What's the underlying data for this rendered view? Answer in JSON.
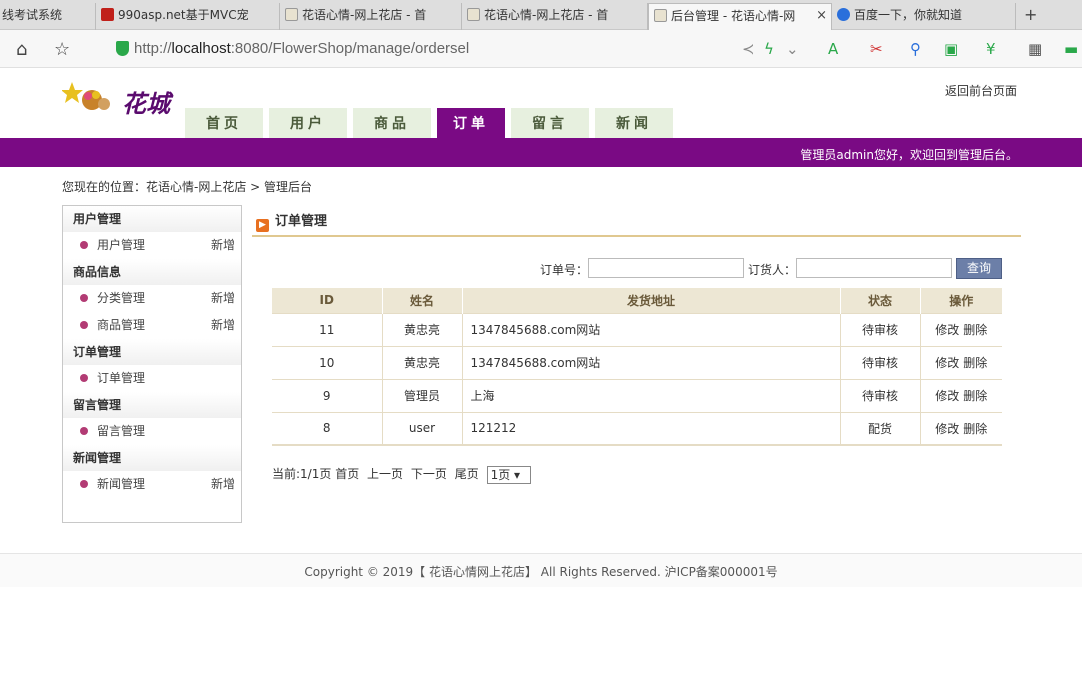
{
  "browser": {
    "tabs": [
      {
        "title": "线考试系统",
        "active": false
      },
      {
        "title": "990asp.net基于MVC宠",
        "active": false
      },
      {
        "title": "花语心情-网上花店 - 首",
        "active": false
      },
      {
        "title": "花语心情-网上花店 - 首",
        "active": false
      },
      {
        "title": "后台管理 - 花语心情-网",
        "active": true
      },
      {
        "title": "百度一下，你就知道",
        "active": false
      }
    ],
    "close_glyph": "×",
    "new_tab_glyph": "+",
    "url_prefix": "http://",
    "url_host": "localhost",
    "url_rest": ":8080/FlowerShop/manage/ordersel"
  },
  "header": {
    "logo_text": "花城",
    "back_link": "返回前台页面",
    "nav": [
      "首页",
      "用户",
      "商品",
      "订单",
      "留言",
      "新闻"
    ],
    "nav_active_index": 3,
    "welcome": "管理员admin您好，欢迎回到管理后台。"
  },
  "breadcrumb": "您现在的位置：花语心情-网上花店 > 管理后台",
  "sidebar": {
    "groups": [
      {
        "title": "用户管理",
        "items": [
          {
            "label": "用户管理",
            "add": "新增"
          }
        ]
      },
      {
        "title": "商品信息",
        "items": [
          {
            "label": "分类管理",
            "add": "新增"
          },
          {
            "label": "商品管理",
            "add": "新增"
          }
        ]
      },
      {
        "title": "订单管理",
        "items": [
          {
            "label": "订单管理",
            "add": ""
          }
        ]
      },
      {
        "title": "留言管理",
        "items": [
          {
            "label": "留言管理",
            "add": ""
          }
        ]
      },
      {
        "title": "新闻管理",
        "items": [
          {
            "label": "新闻管理",
            "add": "新增"
          }
        ]
      }
    ]
  },
  "main": {
    "title": "订单管理",
    "search": {
      "order_no_label": "订单号：",
      "order_no_value": "",
      "orderer_label": "订货人：",
      "orderer_value": "",
      "button": "查询"
    },
    "table": {
      "headers": [
        "ID",
        "姓名",
        "发货地址",
        "状态",
        "操作"
      ],
      "rows": [
        {
          "id": "11",
          "name": "黄忠亮",
          "address": "1347845688.com网站",
          "status": "待审核"
        },
        {
          "id": "10",
          "name": "黄忠亮",
          "address": "1347845688.com网站",
          "status": "待审核"
        },
        {
          "id": "9",
          "name": "管理员",
          "address": "上海",
          "status": "待审核"
        },
        {
          "id": "8",
          "name": "user",
          "address": "121212",
          "status": "配货"
        }
      ],
      "edit_label": "修改",
      "delete_label": "删除"
    },
    "pager": {
      "info": "当前:1/1页",
      "first": "首页",
      "prev": "上一页",
      "next": "下一页",
      "last": "尾页",
      "select_value": "1页"
    }
  },
  "footer": "Copyright © 2019【 花语心情网上花店】 All Rights Reserved. 沪ICP备案000001号",
  "colors": {
    "brand_purple": "#7a0a84",
    "nav_bg": "#e7f0df",
    "table_header": "#ede7d4"
  }
}
